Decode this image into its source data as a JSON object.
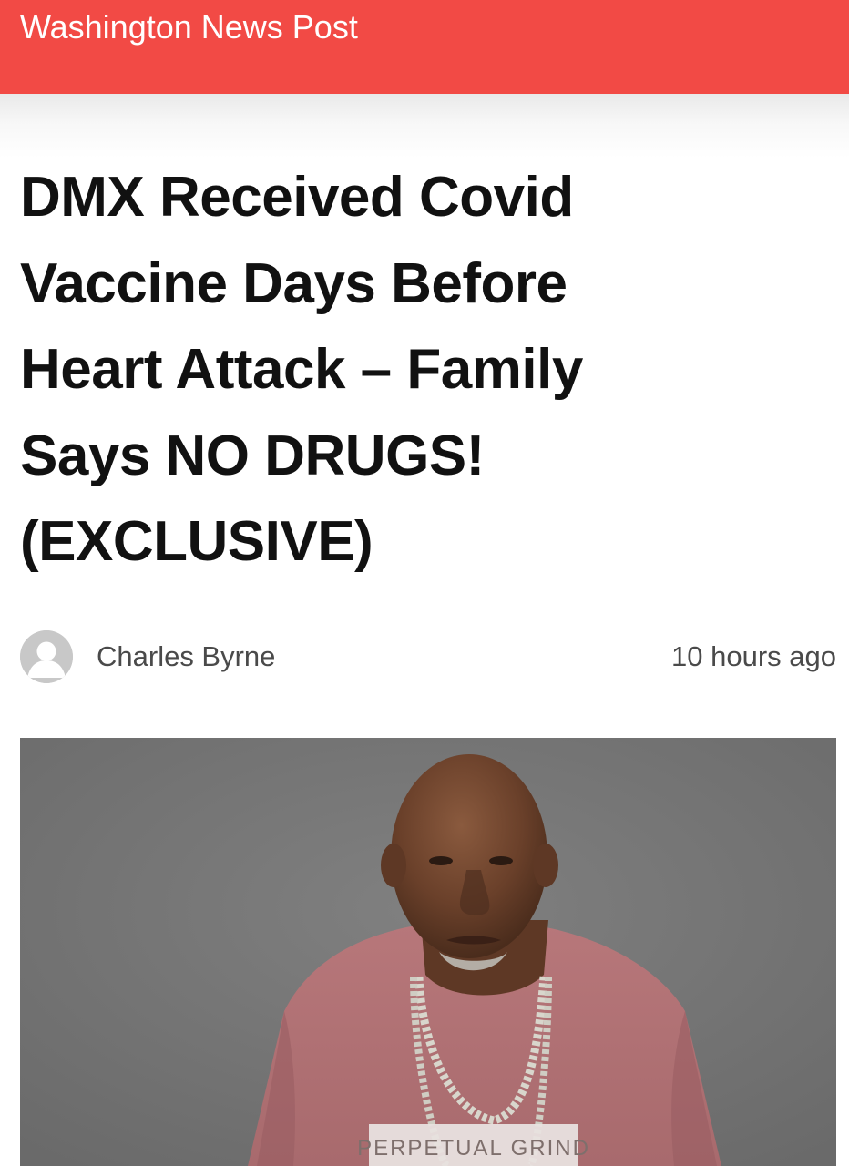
{
  "header": {
    "site_name": "Washington News Post",
    "brand_color": "#f24a45"
  },
  "article": {
    "headline_lines": [
      "DMX Received Covid",
      "Vaccine Days Before",
      "Heart Attack – Family",
      "Says NO DRUGS!",
      "(EXCLUSIVE)"
    ],
    "author": "Charles Byrne",
    "timestamp": "10 hours ago",
    "avatar_icon": "user-avatar-icon",
    "photo": {
      "shirt_text": "PERPETUAL GRIND"
    }
  }
}
